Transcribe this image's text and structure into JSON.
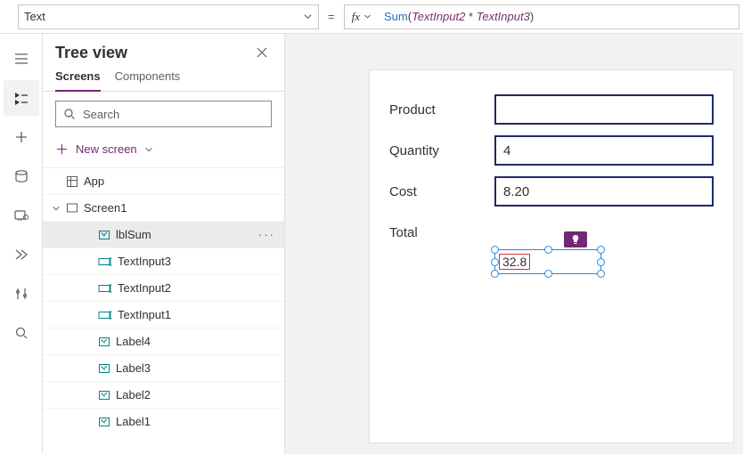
{
  "formula_bar": {
    "property": "Text",
    "fx_label": "fx",
    "fn": "Sum",
    "lparen": "(",
    "ident1": "TextInput2",
    "op": " * ",
    "ident2": "TextInput3",
    "rparen": ")",
    "equals": "="
  },
  "tree": {
    "title": "Tree view",
    "tab_screens": "Screens",
    "tab_components": "Components",
    "search_placeholder": "Search",
    "new_screen": "New screen",
    "app": "App",
    "screen1": "Screen1",
    "items": [
      {
        "label": "lblSum",
        "icon": "label",
        "selected": true
      },
      {
        "label": "TextInput3",
        "icon": "input",
        "selected": false
      },
      {
        "label": "TextInput2",
        "icon": "input",
        "selected": false
      },
      {
        "label": "TextInput1",
        "icon": "input",
        "selected": false
      },
      {
        "label": "Label4",
        "icon": "label",
        "selected": false
      },
      {
        "label": "Label3",
        "icon": "label",
        "selected": false
      },
      {
        "label": "Label2",
        "icon": "label",
        "selected": false
      },
      {
        "label": "Label1",
        "icon": "label",
        "selected": false
      }
    ]
  },
  "canvas": {
    "rows": [
      {
        "label": "Product",
        "value": ""
      },
      {
        "label": "Quantity",
        "value": "4"
      },
      {
        "label": "Cost",
        "value": "8.20"
      }
    ],
    "total_label": "Total",
    "total_value": "32.8"
  },
  "colors": {
    "accent": "#742774",
    "input_border": "#1f2a68",
    "selection": "#2b88d8",
    "error": "#d13438"
  }
}
